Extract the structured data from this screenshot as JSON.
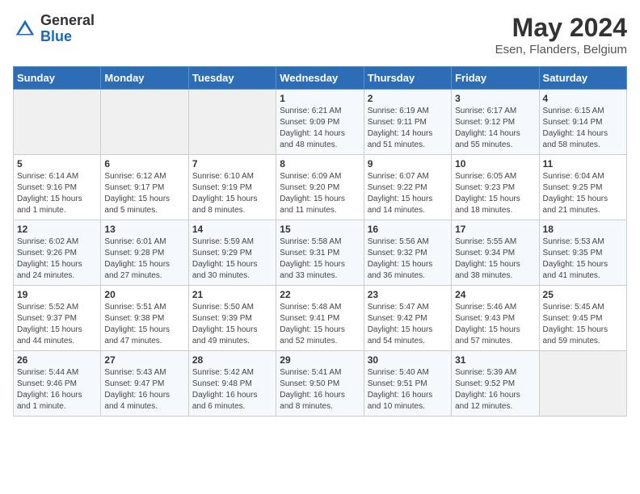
{
  "header": {
    "logo_general": "General",
    "logo_blue": "Blue",
    "month_title": "May 2024",
    "location": "Esen, Flanders, Belgium"
  },
  "days_of_week": [
    "Sunday",
    "Monday",
    "Tuesday",
    "Wednesday",
    "Thursday",
    "Friday",
    "Saturday"
  ],
  "weeks": [
    [
      {
        "day": "",
        "sunrise": "",
        "sunset": "",
        "daylight": ""
      },
      {
        "day": "",
        "sunrise": "",
        "sunset": "",
        "daylight": ""
      },
      {
        "day": "",
        "sunrise": "",
        "sunset": "",
        "daylight": ""
      },
      {
        "day": "1",
        "sunrise": "Sunrise: 6:21 AM",
        "sunset": "Sunset: 9:09 PM",
        "daylight": "Daylight: 14 hours and 48 minutes."
      },
      {
        "day": "2",
        "sunrise": "Sunrise: 6:19 AM",
        "sunset": "Sunset: 9:11 PM",
        "daylight": "Daylight: 14 hours and 51 minutes."
      },
      {
        "day": "3",
        "sunrise": "Sunrise: 6:17 AM",
        "sunset": "Sunset: 9:12 PM",
        "daylight": "Daylight: 14 hours and 55 minutes."
      },
      {
        "day": "4",
        "sunrise": "Sunrise: 6:15 AM",
        "sunset": "Sunset: 9:14 PM",
        "daylight": "Daylight: 14 hours and 58 minutes."
      }
    ],
    [
      {
        "day": "5",
        "sunrise": "Sunrise: 6:14 AM",
        "sunset": "Sunset: 9:16 PM",
        "daylight": "Daylight: 15 hours and 1 minute."
      },
      {
        "day": "6",
        "sunrise": "Sunrise: 6:12 AM",
        "sunset": "Sunset: 9:17 PM",
        "daylight": "Daylight: 15 hours and 5 minutes."
      },
      {
        "day": "7",
        "sunrise": "Sunrise: 6:10 AM",
        "sunset": "Sunset: 9:19 PM",
        "daylight": "Daylight: 15 hours and 8 minutes."
      },
      {
        "day": "8",
        "sunrise": "Sunrise: 6:09 AM",
        "sunset": "Sunset: 9:20 PM",
        "daylight": "Daylight: 15 hours and 11 minutes."
      },
      {
        "day": "9",
        "sunrise": "Sunrise: 6:07 AM",
        "sunset": "Sunset: 9:22 PM",
        "daylight": "Daylight: 15 hours and 14 minutes."
      },
      {
        "day": "10",
        "sunrise": "Sunrise: 6:05 AM",
        "sunset": "Sunset: 9:23 PM",
        "daylight": "Daylight: 15 hours and 18 minutes."
      },
      {
        "day": "11",
        "sunrise": "Sunrise: 6:04 AM",
        "sunset": "Sunset: 9:25 PM",
        "daylight": "Daylight: 15 hours and 21 minutes."
      }
    ],
    [
      {
        "day": "12",
        "sunrise": "Sunrise: 6:02 AM",
        "sunset": "Sunset: 9:26 PM",
        "daylight": "Daylight: 15 hours and 24 minutes."
      },
      {
        "day": "13",
        "sunrise": "Sunrise: 6:01 AM",
        "sunset": "Sunset: 9:28 PM",
        "daylight": "Daylight: 15 hours and 27 minutes."
      },
      {
        "day": "14",
        "sunrise": "Sunrise: 5:59 AM",
        "sunset": "Sunset: 9:29 PM",
        "daylight": "Daylight: 15 hours and 30 minutes."
      },
      {
        "day": "15",
        "sunrise": "Sunrise: 5:58 AM",
        "sunset": "Sunset: 9:31 PM",
        "daylight": "Daylight: 15 hours and 33 minutes."
      },
      {
        "day": "16",
        "sunrise": "Sunrise: 5:56 AM",
        "sunset": "Sunset: 9:32 PM",
        "daylight": "Daylight: 15 hours and 36 minutes."
      },
      {
        "day": "17",
        "sunrise": "Sunrise: 5:55 AM",
        "sunset": "Sunset: 9:34 PM",
        "daylight": "Daylight: 15 hours and 38 minutes."
      },
      {
        "day": "18",
        "sunrise": "Sunrise: 5:53 AM",
        "sunset": "Sunset: 9:35 PM",
        "daylight": "Daylight: 15 hours and 41 minutes."
      }
    ],
    [
      {
        "day": "19",
        "sunrise": "Sunrise: 5:52 AM",
        "sunset": "Sunset: 9:37 PM",
        "daylight": "Daylight: 15 hours and 44 minutes."
      },
      {
        "day": "20",
        "sunrise": "Sunrise: 5:51 AM",
        "sunset": "Sunset: 9:38 PM",
        "daylight": "Daylight: 15 hours and 47 minutes."
      },
      {
        "day": "21",
        "sunrise": "Sunrise: 5:50 AM",
        "sunset": "Sunset: 9:39 PM",
        "daylight": "Daylight: 15 hours and 49 minutes."
      },
      {
        "day": "22",
        "sunrise": "Sunrise: 5:48 AM",
        "sunset": "Sunset: 9:41 PM",
        "daylight": "Daylight: 15 hours and 52 minutes."
      },
      {
        "day": "23",
        "sunrise": "Sunrise: 5:47 AM",
        "sunset": "Sunset: 9:42 PM",
        "daylight": "Daylight: 15 hours and 54 minutes."
      },
      {
        "day": "24",
        "sunrise": "Sunrise: 5:46 AM",
        "sunset": "Sunset: 9:43 PM",
        "daylight": "Daylight: 15 hours and 57 minutes."
      },
      {
        "day": "25",
        "sunrise": "Sunrise: 5:45 AM",
        "sunset": "Sunset: 9:45 PM",
        "daylight": "Daylight: 15 hours and 59 minutes."
      }
    ],
    [
      {
        "day": "26",
        "sunrise": "Sunrise: 5:44 AM",
        "sunset": "Sunset: 9:46 PM",
        "daylight": "Daylight: 16 hours and 1 minute."
      },
      {
        "day": "27",
        "sunrise": "Sunrise: 5:43 AM",
        "sunset": "Sunset: 9:47 PM",
        "daylight": "Daylight: 16 hours and 4 minutes."
      },
      {
        "day": "28",
        "sunrise": "Sunrise: 5:42 AM",
        "sunset": "Sunset: 9:48 PM",
        "daylight": "Daylight: 16 hours and 6 minutes."
      },
      {
        "day": "29",
        "sunrise": "Sunrise: 5:41 AM",
        "sunset": "Sunset: 9:50 PM",
        "daylight": "Daylight: 16 hours and 8 minutes."
      },
      {
        "day": "30",
        "sunrise": "Sunrise: 5:40 AM",
        "sunset": "Sunset: 9:51 PM",
        "daylight": "Daylight: 16 hours and 10 minutes."
      },
      {
        "day": "31",
        "sunrise": "Sunrise: 5:39 AM",
        "sunset": "Sunset: 9:52 PM",
        "daylight": "Daylight: 16 hours and 12 minutes."
      },
      {
        "day": "",
        "sunrise": "",
        "sunset": "",
        "daylight": ""
      }
    ]
  ]
}
